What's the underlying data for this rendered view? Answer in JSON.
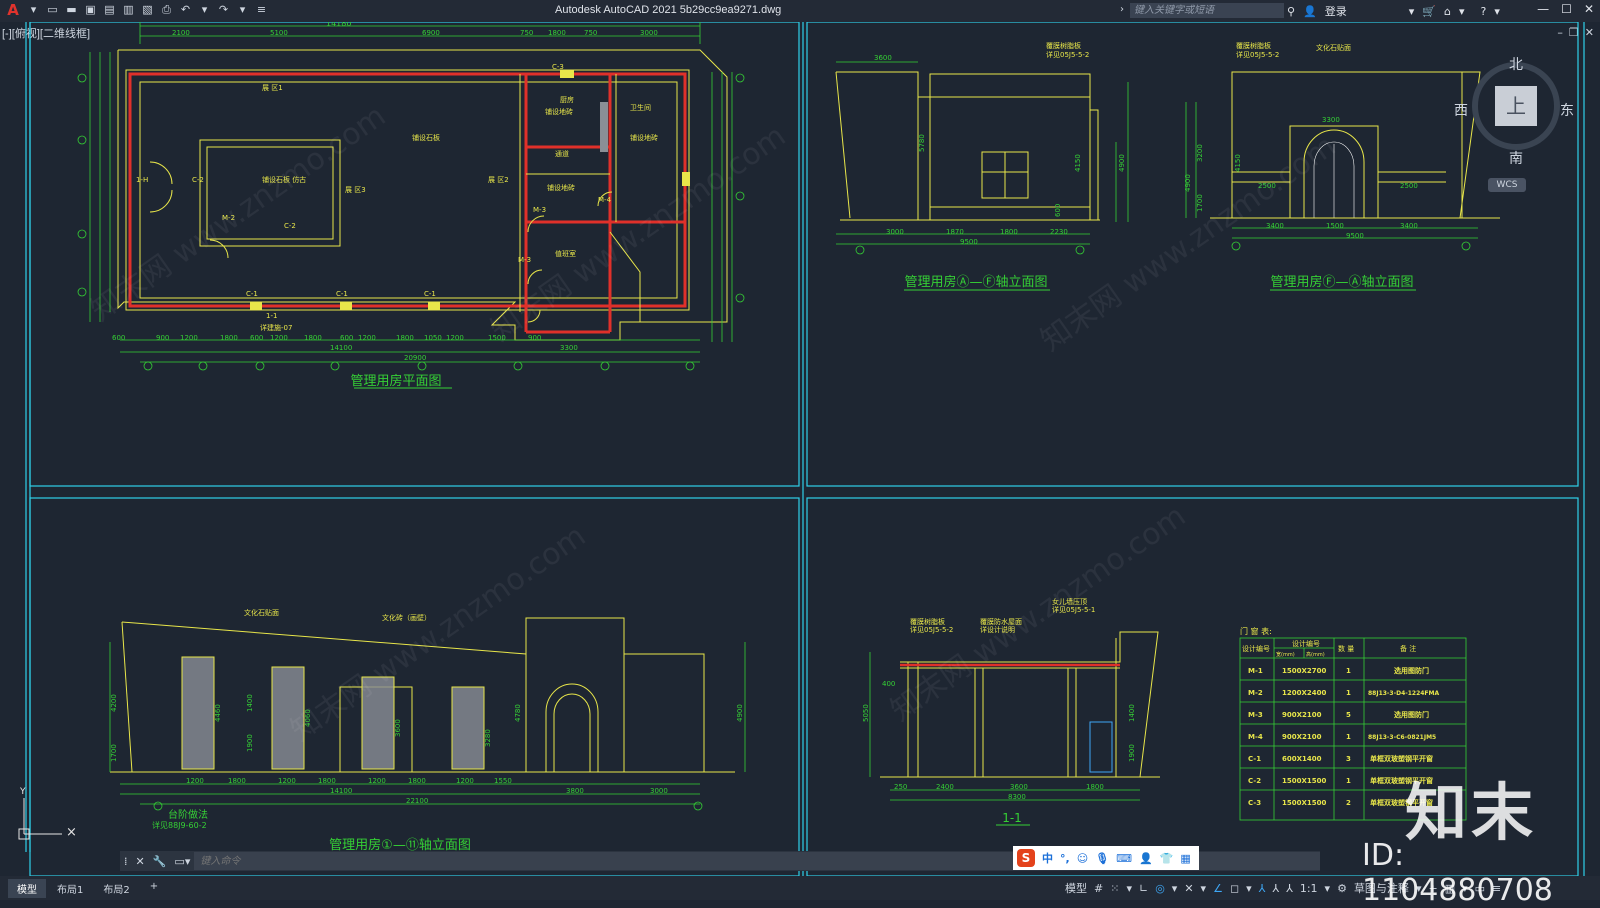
{
  "app": {
    "title": "Autodesk AutoCAD 2021    5b29cc9ea9271.dwg",
    "search_placeholder": "键入关键字或短语",
    "login_label": "登录",
    "viewport_label": "[-][俯视][二维线框]"
  },
  "viewcube": {
    "north": "北",
    "south": "南",
    "east": "东",
    "west": "西",
    "top": "上",
    "wcs": "WCS"
  },
  "drawing": {
    "plan_title": "管理用房平面图",
    "elev1_title": "管理用房Ⓐ—Ⓕ轴立面图",
    "elev2_title": "管理用房Ⓕ—Ⓐ轴立面图",
    "elev3_title": "管理用房①—⑪轴立面图",
    "section_title": "1-1",
    "plan_dims_top": [
      "14180",
      "2100",
      "5100",
      "6900",
      "750",
      "1800",
      "750",
      "3000"
    ],
    "plan_dims_bottom": [
      "600",
      "900",
      "1200",
      "1800",
      "600",
      "1200",
      "1800",
      "600",
      "1200",
      "1800",
      "1050",
      "1200",
      "1500",
      "900"
    ],
    "plan_total_bottom": "14100",
    "plan_total": "20900",
    "plan_sub_total": "3300",
    "plan_rooms": [
      "展 区1",
      "铺设石板",
      "展 区3",
      "展 区2",
      "铺设石板\n仿古",
      "厨房",
      "铺设地砖",
      "卫生间",
      "铺设地砖",
      "通道",
      "铺设地砖",
      "值班室"
    ],
    "plan_labels": [
      "C-3",
      "C-1",
      "C-1",
      "C-1",
      "C-2",
      "C-2",
      "M-2",
      "M-3",
      "M-3",
      "M-4",
      "1-1",
      "1-H"
    ],
    "plan_ref": "详建施-07",
    "elev1_dims": [
      "3600",
      "9500",
      "3000",
      "1870",
      "1800",
      "2230",
      "5780",
      "4150",
      "4900",
      "600"
    ],
    "elev1_notes": [
      "覆膜树脂板",
      "详见05J5-5-2"
    ],
    "elev2_dims": [
      "3300",
      "9500",
      "3400",
      "1500",
      "3400",
      "2500",
      "2500",
      "4900",
      "3200",
      "1700",
      "4150"
    ],
    "elev2_notes": [
      "覆膜树脂板",
      "详见05J5-5-2",
      "文化石贴面"
    ],
    "elev3_dims": [
      "22100",
      "14100",
      "3800",
      "3000",
      "1200",
      "1800",
      "1200",
      "1800",
      "1200",
      "1800",
      "1200",
      "1550",
      "4200",
      "4460",
      "4060",
      "3600",
      "3280",
      "4780",
      "4900",
      "1400",
      "1900",
      "1700"
    ],
    "elev3_notes": [
      "文化石贴面",
      "文化砖（画壁）",
      "台阶做法",
      "详见88J9-60-2"
    ],
    "section_dims": [
      "8300",
      "2400",
      "3600",
      "1800",
      "250",
      "400",
      "5050",
      "1900",
      "1400"
    ],
    "section_notes": [
      "覆膜树脂板",
      "详见05J5-5-2",
      "覆膜防水屋面",
      "详设计说明",
      "女儿墙压顶",
      "详见05J5-5-1"
    ]
  },
  "door_table": {
    "title": "门 窗 表:",
    "headers": [
      "设计编号",
      "设计编号",
      "数 量",
      "备 注"
    ],
    "subheaders": [
      "宽(mm)",
      "高(mm)"
    ],
    "rows": [
      [
        "M-1",
        "1500X2700",
        "1",
        "选用图防门"
      ],
      [
        "M-2",
        "1200X2400",
        "1",
        "88J13-3-D4-1224FMA"
      ],
      [
        "M-3",
        "900X2100",
        "5",
        "选用图防门"
      ],
      [
        "M-4",
        "900X2100",
        "1",
        "88J13-3-C6-0821JM5"
      ],
      [
        "C-1",
        "600X1400",
        "3",
        "单框双玻塑钢平开窗"
      ],
      [
        "C-2",
        "1500X1500",
        "1",
        "单框双玻塑钢平开窗"
      ],
      [
        "C-3",
        "1500X1500",
        "2",
        "单框双玻塑钢平开窗"
      ]
    ]
  },
  "command": {
    "placeholder": "键入命令"
  },
  "ime": {
    "items": [
      "中",
      "°,",
      "☺",
      "🎙",
      "⌨",
      "👤",
      "👕",
      "▦"
    ]
  },
  "status": {
    "tabs": [
      "模型",
      "布局1",
      "布局2",
      "+"
    ],
    "model_label": "模型",
    "scale": "1:1",
    "workspace": "草图与注释"
  },
  "watermark": {
    "brand": "知末",
    "id": "ID: 1104880708",
    "site": "知末网 www.znzmo.com"
  },
  "colors": {
    "bg": "#1e2632",
    "frame": "#2fd0e8",
    "wall": "#e8e64a",
    "dim": "#35d035",
    "red": "#e0302a",
    "hatch": "#8a8f96"
  }
}
